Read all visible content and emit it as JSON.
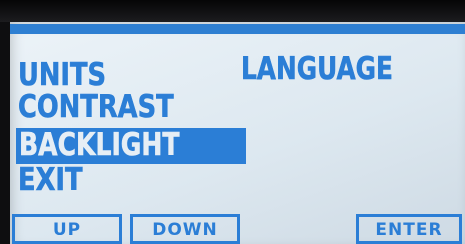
{
  "menu": {
    "items": [
      {
        "label": "UNITS"
      },
      {
        "label": "LANGUAGE"
      },
      {
        "label": "CONTRAST"
      },
      {
        "label": "BACKLIGHT",
        "selected": true
      },
      {
        "label": "EXIT"
      }
    ]
  },
  "softkeys": {
    "up": "UP",
    "down": "DOWN",
    "enter": "ENTER"
  },
  "colors": {
    "lcd_text": "#2b7ed6",
    "lcd_background": "#e4edf4",
    "selection_highlight": "#2b7ed6",
    "bezel": "#0e0e10"
  }
}
